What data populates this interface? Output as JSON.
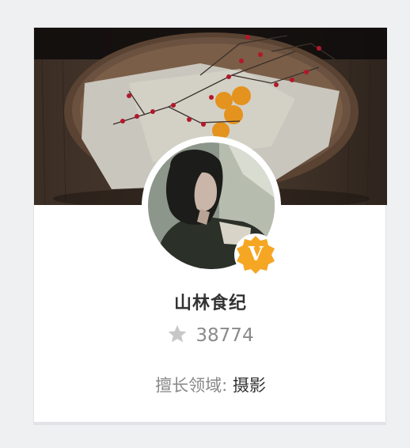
{
  "profile": {
    "name": "山林食纪",
    "verified_badge_letter": "V",
    "star_count": "38774",
    "specialty_label": "擅长领域:",
    "specialty_value": "摄影"
  },
  "icons": {
    "star": "star-icon",
    "verified": "verified-badge-icon"
  },
  "colors": {
    "badge": "#f5a623",
    "star": "#c7c7c7",
    "card_background": "#ffffff",
    "page_background": "#eff0f2"
  }
}
